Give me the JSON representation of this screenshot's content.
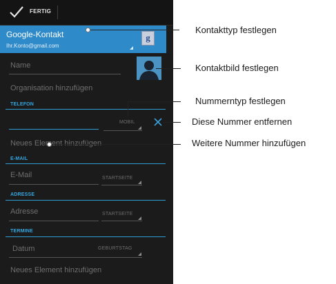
{
  "toolbar": {
    "done_label": "FERTIG",
    "done_icon": "check-icon"
  },
  "account": {
    "name": "Google-Kontakt",
    "email": "Ihr.Konto@gmail.com",
    "icon_letter": "g"
  },
  "fields": {
    "name_placeholder": "Name",
    "organisation": "Organisation hinzufügen"
  },
  "sections": {
    "phone": {
      "header": "TELEFON",
      "number_value": "",
      "type": "MOBIL",
      "add_new": "Neues Element hinzufügen"
    },
    "email": {
      "header": "E-MAIL",
      "placeholder": "E-Mail",
      "type": "STARTSEITE"
    },
    "address": {
      "header": "ADRESSE",
      "placeholder": "Adresse",
      "type": "STARTSEITE"
    },
    "dates": {
      "header": "TERMINE",
      "placeholder": "Datum",
      "type": "GEBURTSTAG",
      "add_new": "Neues Element hinzufügen"
    }
  },
  "callouts": {
    "contact_type": "Kontakttyp festlegen",
    "contact_photo": "Kontaktbild festlegen",
    "number_type": "Nummerntyp festlegen",
    "remove_number": "Diese Nummer entfernen",
    "add_number": "Weitere Nummer hinzufügen"
  },
  "colors": {
    "accent": "#2f8ac9",
    "section_blue": "#33a7e0",
    "background": "#1b1b1b"
  }
}
